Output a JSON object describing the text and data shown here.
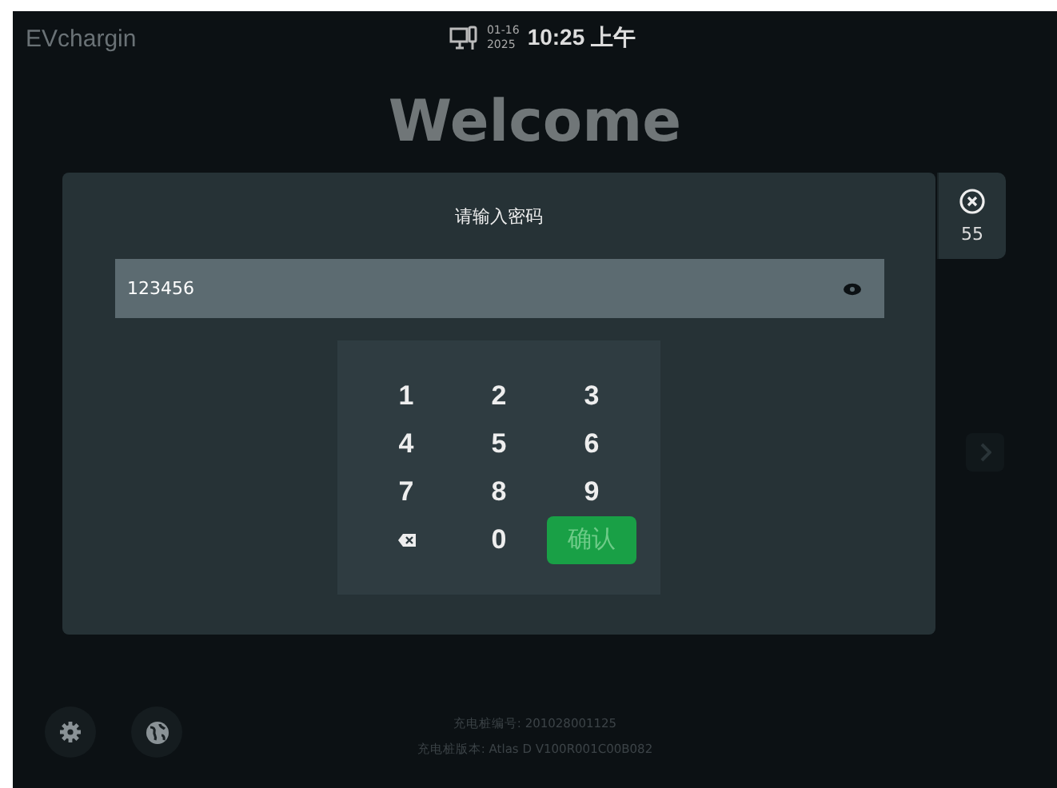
{
  "header": {
    "logo": "EVchargin",
    "date": "01-16",
    "year": "2025",
    "time": "10:25 上午"
  },
  "welcome": "Welcome",
  "dialog": {
    "title": "请输入密码",
    "password": {
      "value": "123456"
    },
    "close_countdown": "55",
    "keypad": [
      {
        "kind": "digit",
        "label": "1"
      },
      {
        "kind": "digit",
        "label": "2"
      },
      {
        "kind": "digit",
        "label": "3"
      },
      {
        "kind": "digit",
        "label": "4"
      },
      {
        "kind": "digit",
        "label": "5"
      },
      {
        "kind": "digit",
        "label": "6"
      },
      {
        "kind": "digit",
        "label": "7"
      },
      {
        "kind": "digit",
        "label": "8"
      },
      {
        "kind": "digit",
        "label": "9"
      },
      {
        "kind": "backspace"
      },
      {
        "kind": "digit",
        "label": "0"
      },
      {
        "kind": "confirm",
        "label": "确认"
      }
    ]
  },
  "footer": {
    "serial": "充电桩编号: 201028001125",
    "version": "充电桩版本: Atlas D V100R001C00B082"
  }
}
